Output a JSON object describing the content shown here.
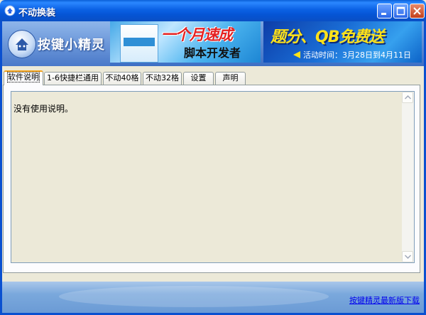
{
  "window": {
    "title": "不动换装",
    "controls": [
      "minimize",
      "maximize",
      "close"
    ]
  },
  "header": {
    "logo_text": "按键小精灵",
    "ad1": {
      "line1": "一个月速成",
      "line2": "脚本开发者"
    },
    "ad2": {
      "headline": "题分、QB免费送",
      "activity_time": "活动时间：3月28日到4月11日"
    }
  },
  "tabs": [
    {
      "label": "软件说明",
      "active": true
    },
    {
      "label": "1-6快捷栏通用",
      "active": false
    },
    {
      "label": "不动40格",
      "active": false
    },
    {
      "label": "不动32格",
      "active": false
    },
    {
      "label": "设置",
      "active": false
    },
    {
      "label": "声明",
      "active": false
    }
  ],
  "content": {
    "text": "没有使用说明。"
  },
  "footer": {
    "link_text": "按键精灵最新版下载"
  },
  "colors": {
    "titlebar": "#0b61e4",
    "window_bg": "#ece9d8",
    "tab_active_border": "#f4a31c",
    "link": "#0000ee"
  }
}
